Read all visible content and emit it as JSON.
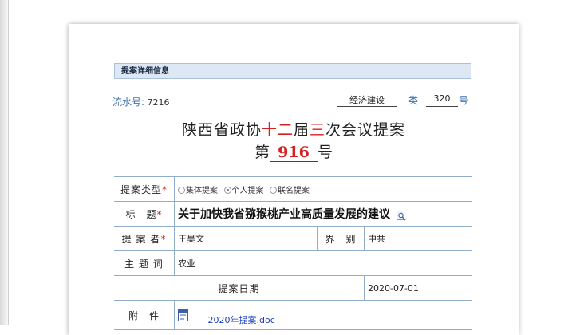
{
  "section_title": "提案详细信息",
  "serial": {
    "label": "流水号:",
    "value": "7216"
  },
  "category": {
    "name": "经济建设",
    "unit_label": "类",
    "number": "320",
    "number_suffix": "号"
  },
  "heading": {
    "part1": "陕西省政协",
    "part2": "十二",
    "part3": "届",
    "part4": "三",
    "part5": "次会议提案",
    "prefix": "第",
    "number": "916",
    "suffix": "号"
  },
  "form": {
    "type_label": "提案类型",
    "types": [
      {
        "label": "集体提案",
        "selected": false
      },
      {
        "label": "个人提案",
        "selected": true
      },
      {
        "label": "联名提案",
        "selected": false
      }
    ],
    "title_label": "标　题",
    "title_value": "关于加快我省猕猴桃产业高质量发展的建议",
    "proposer_label": "提 案 者",
    "proposer_value": "王昊文",
    "sector_label": "界　别",
    "sector_value": "中共",
    "theme_label": "主 题 词",
    "theme_value": "农业",
    "date_label": "提案日期",
    "date_value": "2020-07-01",
    "attachment_label": "附　件",
    "attachment_file": "2020年提案.doc"
  },
  "required_mark": "*",
  "colors": {
    "accent_red": "#d42020",
    "label_blue": "#3b6fb0",
    "header_bg": "#dde8f4"
  }
}
